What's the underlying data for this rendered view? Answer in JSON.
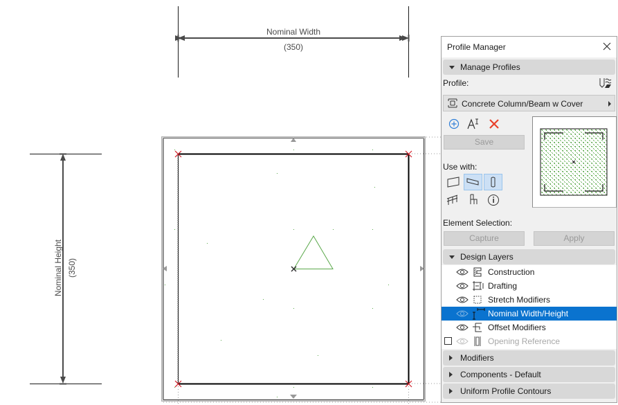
{
  "drawing": {
    "width_dimension": {
      "label": "Nominal Width",
      "value": "(350)"
    },
    "height_dimension": {
      "label": "Nominal Height",
      "value": "(350)"
    }
  },
  "panel": {
    "title": "Profile Manager",
    "manage_profiles": {
      "header": "Manage Profiles",
      "profile_label": "Profile:",
      "profile_value": "Concrete Column/Beam w Cover",
      "save_label": "Save",
      "use_with_label": "Use with:",
      "use_with": [
        {
          "icon": "wall-icon",
          "selected": false
        },
        {
          "icon": "beam-icon",
          "selected": true
        },
        {
          "icon": "column-icon",
          "selected": true
        },
        {
          "icon": "railing-icon",
          "selected": false
        },
        {
          "icon": "object-icon",
          "selected": false
        },
        {
          "icon": "info-icon",
          "selected": false
        }
      ],
      "element_selection_label": "Element Selection:",
      "capture_label": "Capture",
      "apply_label": "Apply"
    },
    "design_layers": {
      "header": "Design Layers",
      "items": [
        {
          "label": "Construction",
          "icon": "construction-icon",
          "visible": true,
          "selected": false,
          "disabled": false
        },
        {
          "label": "Drafting",
          "icon": "drafting-icon",
          "visible": true,
          "selected": false,
          "disabled": false
        },
        {
          "label": "Stretch Modifiers",
          "icon": "stretch-modifiers-icon",
          "visible": true,
          "selected": false,
          "disabled": false
        },
        {
          "label": "Nominal Width/Height",
          "icon": "nominal-width-height-icon",
          "visible": true,
          "selected": true,
          "disabled": false
        },
        {
          "label": "Offset Modifiers",
          "icon": "offset-modifiers-icon",
          "visible": true,
          "selected": false,
          "disabled": false
        },
        {
          "label": "Opening Reference",
          "icon": "opening-reference-icon",
          "visible": false,
          "selected": false,
          "disabled": true,
          "checkbox": false
        }
      ]
    },
    "collapsed_sections": [
      "Modifiers",
      "Components - Default",
      "Uniform Profile Contours"
    ]
  },
  "colors": {
    "accent": "#0a73cf",
    "hotspot": "#d0202a",
    "fill_pattern": "#5aa84a",
    "delete": "#e8412c",
    "add": "#2f7ed8"
  }
}
